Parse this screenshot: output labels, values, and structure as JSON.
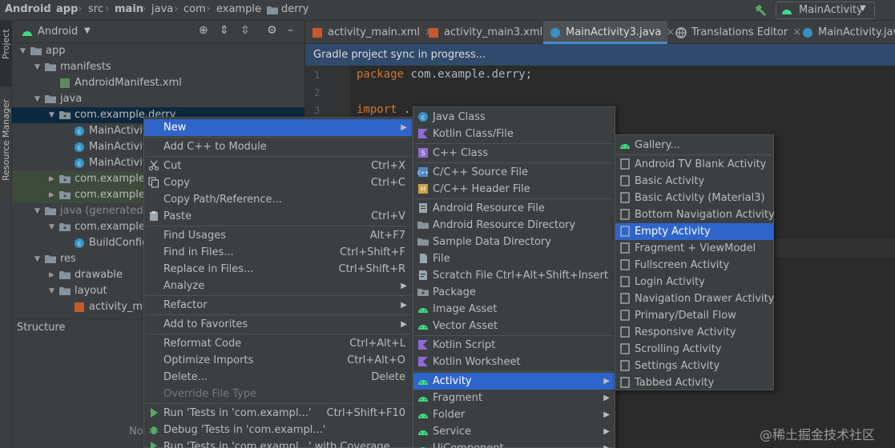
{
  "breadcrumb": [
    "Android",
    "app",
    "src",
    "main",
    "java",
    "com",
    "example",
    "derry"
  ],
  "run_config": "MainActivity",
  "stripe": {
    "project": "Project",
    "resource_manager": "Resource Manager"
  },
  "project_panel": {
    "view_mode": "Android",
    "tree": [
      {
        "label": "app",
        "depth": 0
      },
      {
        "label": "manifests",
        "depth": 1
      },
      {
        "label": "AndroidManifest.xml",
        "depth": 2
      },
      {
        "label": "java",
        "depth": 1
      },
      {
        "label": "com.example.derry",
        "depth": 2
      },
      {
        "label": "MainActivity",
        "depth": 3
      },
      {
        "label": "MainActivity",
        "depth": 3
      },
      {
        "label": "MainActivity",
        "depth": 3
      },
      {
        "label": "com.example.c",
        "depth": 2
      },
      {
        "label": "com.example.c",
        "depth": 2
      },
      {
        "label": "java (generated)",
        "depth": 1
      },
      {
        "label": "com.example.c",
        "depth": 2
      },
      {
        "label": "BuildConfig",
        "depth": 3
      },
      {
        "label": "res",
        "depth": 1
      },
      {
        "label": "drawable",
        "depth": 2
      },
      {
        "label": "layout",
        "depth": 2
      },
      {
        "label": "activity_main",
        "depth": 3
      }
    ]
  },
  "structure_panel": {
    "title": "Structure",
    "hint": "No"
  },
  "tabs": [
    "activity_main.xml",
    "activity_main3.xml",
    "MainActivity3.java",
    "Translations Editor",
    "MainActivity.java"
  ],
  "banner": "Gradle project sync in progress...",
  "editor": {
    "line_numbers": [
      "1",
      "2",
      "3"
    ],
    "line1_keyword": "package",
    "line1_rest": " com.example.derry;",
    "line3_keyword": "import",
    "line3_rest": " .."
  },
  "context_menu": [
    {
      "label": "New",
      "submenu": true,
      "selected": true
    },
    {
      "sep": true
    },
    {
      "label": "Add C++ to Module"
    },
    {
      "sep": true
    },
    {
      "label": "Cut",
      "shortcut": "Ctrl+X",
      "icon": "scissors-icon"
    },
    {
      "label": "Copy",
      "shortcut": "Ctrl+C",
      "icon": "copy-icon"
    },
    {
      "label": "Copy Path/Reference..."
    },
    {
      "label": "Paste",
      "shortcut": "Ctrl+V",
      "icon": "paste-icon"
    },
    {
      "sep": true
    },
    {
      "label": "Find Usages",
      "shortcut": "Alt+F7"
    },
    {
      "label": "Find in Files...",
      "shortcut": "Ctrl+Shift+F"
    },
    {
      "label": "Replace in Files...",
      "shortcut": "Ctrl+Shift+R"
    },
    {
      "label": "Analyze",
      "submenu": true
    },
    {
      "sep": true
    },
    {
      "label": "Refactor",
      "submenu": true
    },
    {
      "sep": true
    },
    {
      "label": "Add to Favorites",
      "submenu": true
    },
    {
      "sep": true
    },
    {
      "label": "Reformat Code",
      "shortcut": "Ctrl+Alt+L"
    },
    {
      "label": "Optimize Imports",
      "shortcut": "Ctrl+Alt+O"
    },
    {
      "label": "Delete...",
      "shortcut": "Delete"
    },
    {
      "label": "Override File Type",
      "disabled": true
    },
    {
      "sep": true
    },
    {
      "label": "Run 'Tests in 'com.exampl...'",
      "shortcut": "Ctrl+Shift+F10",
      "icon": "run-icon"
    },
    {
      "label": "Debug 'Tests in 'com.exampl...'",
      "icon": "debug-icon"
    },
    {
      "label": "Run 'Tests in 'com.exampl...' with Coverage",
      "icon": "coverage-icon"
    }
  ],
  "new_menu": [
    {
      "label": "Java Class",
      "icon": "java-class-icon"
    },
    {
      "label": "Kotlin Class/File",
      "icon": "kotlin-icon"
    },
    {
      "sep": true
    },
    {
      "label": "C++ Class",
      "icon": "cpp-class-icon"
    },
    {
      "sep": true
    },
    {
      "label": "C/C++ Source File",
      "icon": "cpp-source-icon"
    },
    {
      "label": "C/C++ Header File",
      "icon": "cpp-header-icon"
    },
    {
      "sep": true
    },
    {
      "label": "Android Resource File",
      "icon": "resource-file-icon"
    },
    {
      "label": "Android Resource Directory",
      "icon": "folder-icon"
    },
    {
      "label": "Sample Data Directory",
      "icon": "folder-icon"
    },
    {
      "label": "File",
      "icon": "file-icon"
    },
    {
      "label": "Scratch File",
      "shortcut": "Ctrl+Alt+Shift+Insert",
      "icon": "scratch-icon"
    },
    {
      "label": "Package",
      "icon": "package-icon"
    },
    {
      "label": "Image Asset",
      "icon": "android-icon"
    },
    {
      "label": "Vector Asset",
      "icon": "android-icon"
    },
    {
      "sep": true
    },
    {
      "label": "Kotlin Script",
      "icon": "kotlin-icon"
    },
    {
      "label": "Kotlin Worksheet",
      "icon": "kotlin-icon"
    },
    {
      "sep": true
    },
    {
      "label": "Activity",
      "submenu": true,
      "selected": true,
      "icon": "android-icon"
    },
    {
      "label": "Fragment",
      "submenu": true,
      "icon": "android-icon"
    },
    {
      "label": "Folder",
      "submenu": true,
      "icon": "android-icon"
    },
    {
      "label": "Service",
      "submenu": true,
      "icon": "android-icon"
    },
    {
      "label": "UiComponent",
      "submenu": true,
      "icon": "android-icon"
    }
  ],
  "activity_menu": [
    {
      "label": "Gallery...",
      "icon": "android-icon"
    },
    {
      "sep": true
    },
    {
      "label": "Android TV Blank Activity",
      "icon": "page-icon"
    },
    {
      "label": "Basic Activity",
      "icon": "page-icon"
    },
    {
      "label": "Basic Activity (Material3)",
      "icon": "page-icon"
    },
    {
      "label": "Bottom Navigation Activity",
      "icon": "page-icon"
    },
    {
      "label": "Empty Activity",
      "icon": "page-icon",
      "selected": true
    },
    {
      "label": "Fragment + ViewModel",
      "icon": "page-icon"
    },
    {
      "label": "Fullscreen Activity",
      "icon": "page-icon"
    },
    {
      "label": "Login Activity",
      "icon": "page-icon"
    },
    {
      "label": "Navigation Drawer Activity",
      "icon": "page-icon"
    },
    {
      "label": "Primary/Detail Flow",
      "icon": "page-icon"
    },
    {
      "label": "Responsive Activity",
      "icon": "page-icon"
    },
    {
      "label": "Scrolling Activity",
      "icon": "page-icon"
    },
    {
      "label": "Settings Activity",
      "icon": "page-icon"
    },
    {
      "label": "Tabbed Activity",
      "icon": "page-icon"
    }
  ],
  "watermark": "@稀土掘金技术社区",
  "colors": {
    "selection": "#2f65ca",
    "banner": "#2f4a6b",
    "android_green": "#3ddc84",
    "keyword": "#cc7832"
  }
}
